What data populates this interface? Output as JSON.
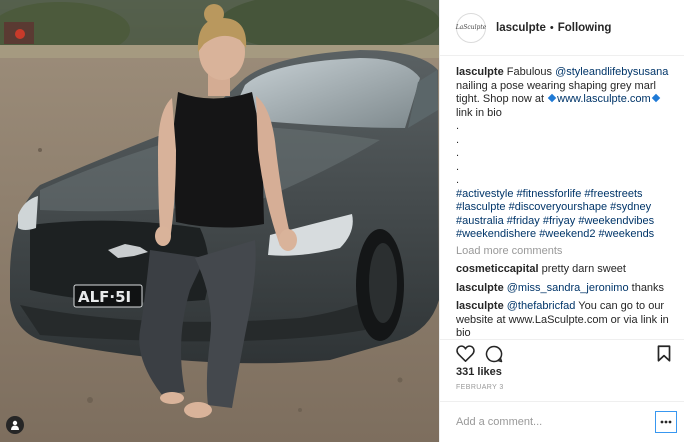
{
  "header": {
    "avatar_text": "LaSculpte",
    "username": "lasculpte",
    "separator": "•",
    "follow_status": "Following"
  },
  "caption": {
    "username": "lasculpte",
    "text_before_mention": "Fabulous",
    "mention": "@styleandlifebysusana",
    "text_after_mention": "nailing a pose wearing shaping grey marl tight. Shop now at",
    "link": "www.lasculpte.com",
    "text_after_link": "link in bio",
    "dots": [
      ".",
      ".",
      ".",
      ".",
      "."
    ],
    "hashtags": [
      "#activestyle",
      "#fitnessforlife",
      "#freestreets",
      "#lasculpte",
      "#discoveryourshape",
      "#sydney",
      "#australia",
      "#friday",
      "#friyay",
      "#weekendvibes",
      "#weekendishere",
      "#weekend2",
      "#weekends"
    ]
  },
  "load_more": "Load more comments",
  "comments": [
    {
      "username": "cosmeticcapital",
      "text": "pretty darn sweet"
    },
    {
      "username": "lasculpte",
      "mention": "@miss_sandra_jeronimo",
      "text": "thanks"
    },
    {
      "username": "lasculpte",
      "mention": "@thefabricfad",
      "text": "You can go to our website at www.LaSculpte.com or via link in bio"
    }
  ],
  "likes": "331 likes",
  "date": "FEBRUARY 3",
  "comment_placeholder": "Add a comment...",
  "photo": {
    "license_plate": "ALF·5I"
  },
  "colors": {
    "link_blue": "#003569",
    "accent_blue": "#3897f0",
    "muted_gray": "#999999",
    "divider": "#efefef"
  },
  "icons": [
    "heart-icon",
    "comment-icon",
    "bookmark-icon",
    "more-options-icon",
    "user-tag-icon"
  ]
}
